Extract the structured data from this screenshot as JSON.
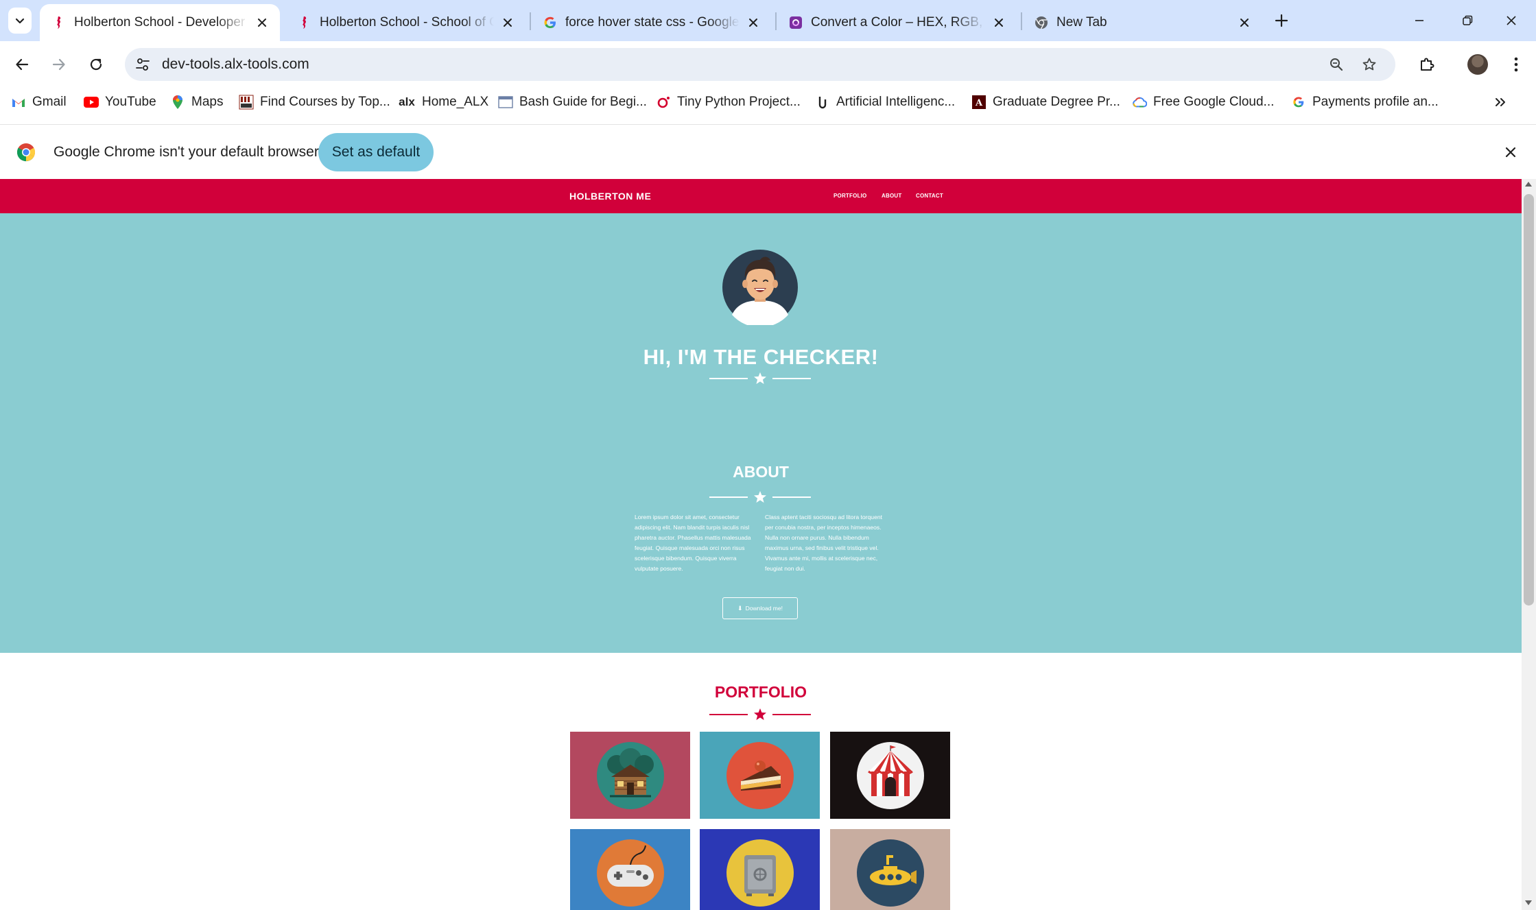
{
  "browser": {
    "tabs": [
      {
        "title": "Holberton School - Developer tools",
        "active": true,
        "favicon": "holberton-seahorse-icon"
      },
      {
        "title": "Holberton School - School of Computer Science",
        "active": false,
        "favicon": "holberton-seahorse-icon"
      },
      {
        "title": "force hover state css - Google Search",
        "active": false,
        "favicon": "google-g-icon"
      },
      {
        "title": "Convert a Color – HEX, RGB, HSL",
        "active": false,
        "favicon": "color-converter-icon"
      },
      {
        "title": "New Tab",
        "active": false,
        "favicon": "chrome-icon"
      }
    ],
    "url": "dev-tools.alx-tools.com",
    "bookmarks": [
      {
        "label": "Gmail",
        "icon": "gmail-icon"
      },
      {
        "label": "YouTube",
        "icon": "youtube-icon"
      },
      {
        "label": "Maps",
        "icon": "maps-icon"
      },
      {
        "label": "Find Courses by Top...",
        "icon": "mit-ocw-icon"
      },
      {
        "label": "Home_ALX",
        "icon": "alx-icon"
      },
      {
        "label": "Bash Guide for Begi...",
        "icon": "page-icon"
      },
      {
        "label": "Tiny Python Project...",
        "icon": "oreilly-icon"
      },
      {
        "label": "Artificial Intelligenc...",
        "icon": "udacity-icon"
      },
      {
        "label": "Graduate Degree Pr...",
        "icon": "tamu-icon"
      },
      {
        "label": "Free Google Cloud...",
        "icon": "google-cloud-icon"
      },
      {
        "label": "Payments profile an...",
        "icon": "google-g-icon"
      }
    ],
    "infobar": {
      "message": "Google Chrome isn't your default browser",
      "button": "Set as default"
    }
  },
  "page": {
    "nav": {
      "brand": "HOLBERTON ME",
      "links": [
        "PORTFOLIO",
        "ABOUT",
        "CONTACT"
      ]
    },
    "hero": {
      "title": "HI, I'M THE CHECKER!"
    },
    "about": {
      "title": "ABOUT",
      "col1": "Lorem ipsum dolor sit amet, consectetur adipiscing elit. Nam blandit turpis iaculis nisl pharetra auctor. Phasellus mattis malesuada feugiat. Quisque malesuada orci non risus scelerisque bibendum. Quisque viverra vulputate posuere.",
      "col2": "Class aptent taciti sociosqu ad litora torquent per conubia nostra, per inceptos himenaeos. Nulla non ornare purus. Nulla bibendum maximus urna, sed finibus velit tristique vel. Vivamus ante mi, mollis at scelerisque nec, feugiat non dui.",
      "download_label": "Download me!"
    },
    "portfolio": {
      "title": "PORTFOLIO",
      "items": [
        {
          "name": "cabin",
          "bg": "#b3485f"
        },
        {
          "name": "cake",
          "bg": "#4aa5b9"
        },
        {
          "name": "circus",
          "bg": "#171111"
        },
        {
          "name": "game",
          "bg": "#3c84c4"
        },
        {
          "name": "safe",
          "bg": "#2b38b5"
        },
        {
          "name": "submarine",
          "bg": "#c8ada0"
        }
      ]
    },
    "colors": {
      "accent": "#d1003a",
      "hero_bg": "#8accd1",
      "white": "#ffffff"
    }
  }
}
